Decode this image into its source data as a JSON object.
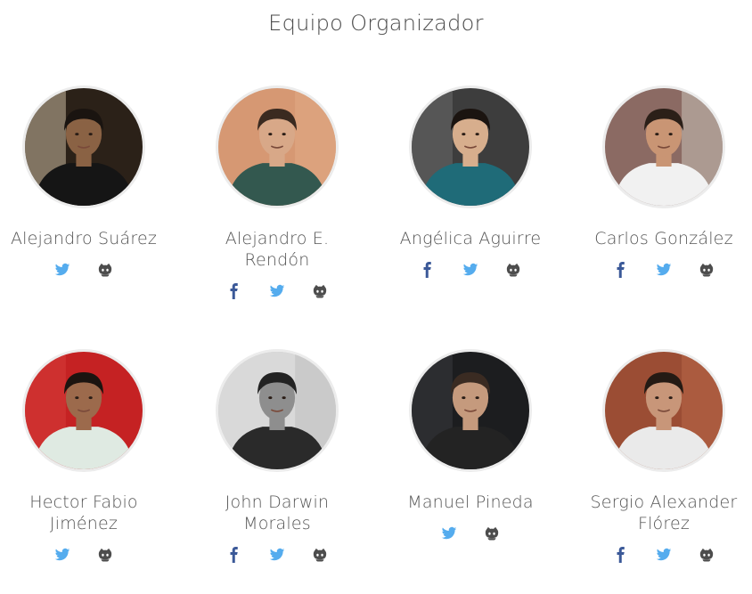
{
  "section": {
    "title": "Equipo Organizador"
  },
  "colors": {
    "facebook": "#3b5998",
    "twitter": "#55acee",
    "github": "#4d4d4d"
  },
  "members": [
    {
      "name": "Alejandro Suárez",
      "links": [
        "twitter",
        "github"
      ],
      "photo": {
        "bg": "#2b2118",
        "wall": "#c9b9a0",
        "shirt": "#151515",
        "skin": "#8a6244",
        "hair": "#1a1410"
      }
    },
    {
      "name": "Alejandro E. Rendón",
      "links": [
        "facebook",
        "twitter",
        "github"
      ],
      "photo": {
        "bg": "#d69873",
        "wall": "#e2ab85",
        "shirt": "#33584f",
        "skin": "#d8a888",
        "hair": "#3a2a20"
      }
    },
    {
      "name": "Angélica Aguirre",
      "links": [
        "facebook",
        "twitter",
        "github"
      ],
      "photo": {
        "bg": "#3d3d3d",
        "wall": "#6b6b6b",
        "shirt": "#1f6b78",
        "skin": "#d7ae8d",
        "hair": "#1b1410"
      }
    },
    {
      "name": "Carlos González",
      "links": [
        "facebook",
        "twitter",
        "github"
      ],
      "photo": {
        "bg": "#8b6a63",
        "wall": "#c8c1b8",
        "shirt": "#f1f1f1",
        "skin": "#c99574",
        "hair": "#2b1f18"
      }
    },
    {
      "name": "Hector Fabio Jiménez",
      "links": [
        "twitter",
        "github"
      ],
      "photo": {
        "bg": "#c52223",
        "wall": "#d63c3a",
        "shirt": "#dfeae2",
        "skin": "#9c6a4c",
        "hair": "#1c1410"
      }
    },
    {
      "name": "John Darwin Morales",
      "links": [
        "facebook",
        "twitter",
        "github"
      ],
      "photo": {
        "bg": "#d9d9d9",
        "wall": "#bdbdbd",
        "shirt": "#2a2a2a",
        "skin": "#8e8e8e",
        "hair": "#222"
      }
    },
    {
      "name": "Manuel Pineda",
      "links": [
        "twitter",
        "github"
      ],
      "photo": {
        "bg": "#1c1d1f",
        "wall": "#3a3b3e",
        "shirt": "#232323",
        "skin": "#c59a7d",
        "hair": "#3a2b22"
      }
    },
    {
      "name": "Sergio Alexander Flórez",
      "links": [
        "facebook",
        "twitter",
        "github"
      ],
      "photo": {
        "bg": "#9b4d34",
        "wall": "#b86748",
        "shirt": "#eaeaea",
        "skin": "#c89679",
        "hair": "#241a14"
      }
    }
  ]
}
